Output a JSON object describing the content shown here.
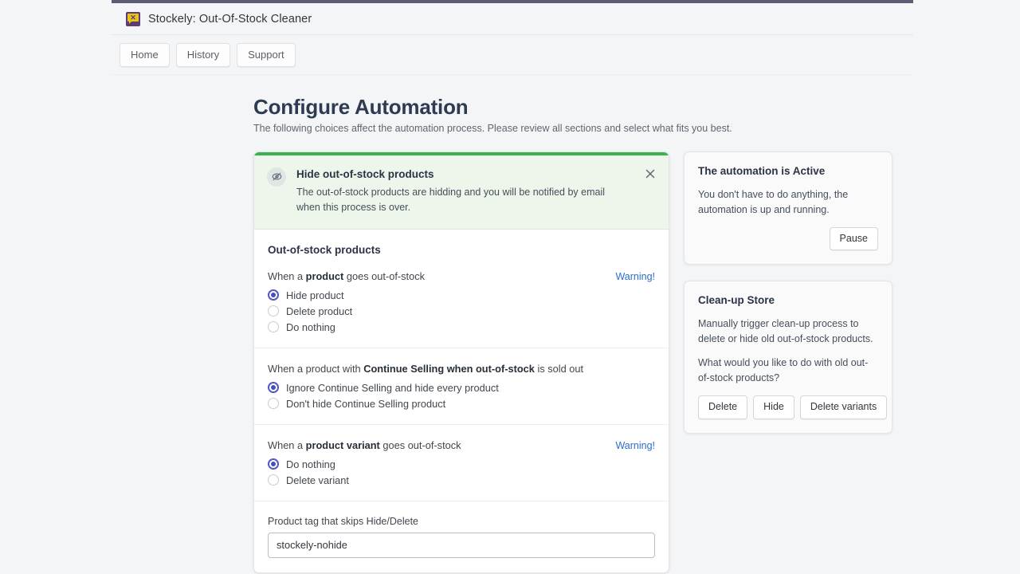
{
  "app": {
    "icon_name": "stockely-app-icon",
    "title": "Stockely: Out-Of-Stock Cleaner",
    "accent_top_border": "#5c5c75",
    "nav": [
      {
        "label": "Home"
      },
      {
        "label": "History"
      },
      {
        "label": "Support"
      }
    ]
  },
  "page": {
    "title": "Configure Automation",
    "subtitle": "The following choices affect the automation process. Please review all sections and select what fits you best."
  },
  "banner": {
    "accent_color": "#37b24d",
    "background": "#eef6ec",
    "icon_name": "eye-slash-icon",
    "title": "Hide out-of-stock products",
    "text": "The out-of-stock products are hidding and you will be notified by email when this process is over.",
    "close_icon": "close-icon"
  },
  "out_of_stock_section": {
    "title": "Out-of-stock products",
    "groups": [
      {
        "question_prefix": "When a ",
        "question_strong": "product",
        "question_suffix": " goes out-of-stock",
        "warning_label": "Warning!",
        "options": [
          {
            "label": "Hide product",
            "checked": true
          },
          {
            "label": "Delete product",
            "checked": false
          },
          {
            "label": "Do nothing",
            "checked": false
          }
        ]
      },
      {
        "question_prefix": "When a product with ",
        "question_strong": "Continue Selling when out-of-stock",
        "question_suffix": " is sold out",
        "warning_label": "",
        "options": [
          {
            "label": "Ignore Continue Selling and hide every product",
            "checked": true
          },
          {
            "label": "Don't hide Continue Selling product",
            "checked": false
          }
        ]
      },
      {
        "question_prefix": "When a ",
        "question_strong": "product variant",
        "question_suffix": " goes out-of-stock",
        "warning_label": "Warning!",
        "options": [
          {
            "label": "Do nothing",
            "checked": true
          },
          {
            "label": "Delete variant",
            "checked": false
          }
        ]
      }
    ],
    "tag_field": {
      "label": "Product tag that skips Hide/Delete",
      "value": "stockely-nohide",
      "placeholder": "stockely-nohide"
    }
  },
  "sidebar": {
    "automation_card": {
      "title": "The automation is Active",
      "text": "You don't have to do anything, the automation is up and running.",
      "button_label": "Pause"
    },
    "cleanup_card": {
      "title": "Clean-up Store",
      "text_1": "Manually trigger clean-up process to delete or hide old out-of-stock products.",
      "text_2": "What would you like to do with old out-of-stock products?",
      "buttons": [
        {
          "label": "Delete"
        },
        {
          "label": "Hide"
        },
        {
          "label": "Delete variants"
        }
      ]
    }
  },
  "colors": {
    "link": "#2c6ecb",
    "radio_selected": "#4550b8",
    "page_background": "#f4f5f7"
  }
}
